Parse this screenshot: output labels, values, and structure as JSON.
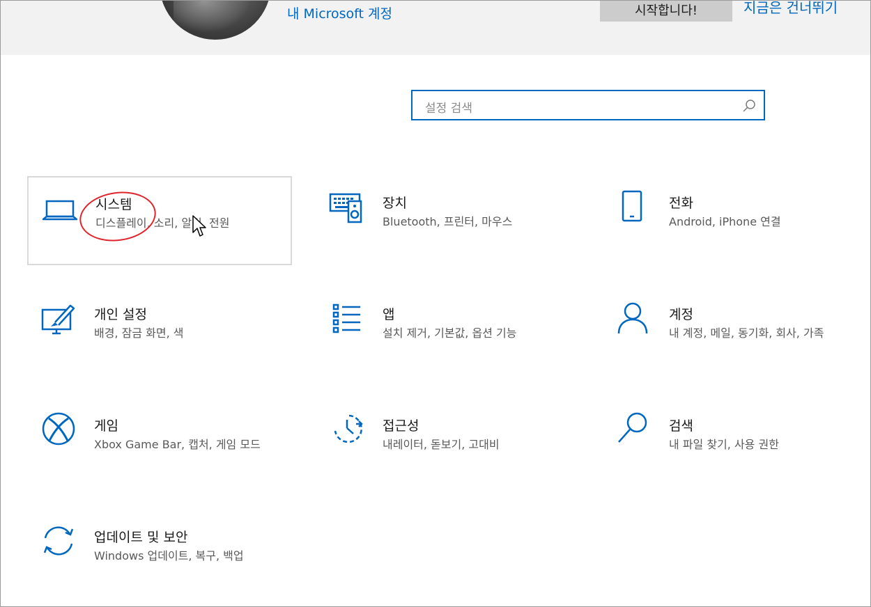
{
  "header": {
    "account_link": "내 Microsoft 계정",
    "start_button": "시작합니다!",
    "skip_link": "지금은 건너뛰기"
  },
  "search": {
    "placeholder": "설정 검색",
    "icon": "search-icon"
  },
  "tiles": [
    {
      "id": "system",
      "icon": "laptop-icon",
      "title": "시스템",
      "desc": "디스플레이, 소리, 알림, 전원",
      "selected": true
    },
    {
      "id": "devices",
      "icon": "keyboard-speaker-icon",
      "title": "장치",
      "desc": "Bluetooth, 프린터, 마우스"
    },
    {
      "id": "phone",
      "icon": "phone-icon",
      "title": "전화",
      "desc": "Android, iPhone 연결"
    },
    {
      "id": "personalization",
      "icon": "personalization-icon",
      "title": "개인 설정",
      "desc": "배경, 잠금 화면, 색"
    },
    {
      "id": "apps",
      "icon": "apps-list-icon",
      "title": "앱",
      "desc": "설치 제거, 기본값, 옵션 기능"
    },
    {
      "id": "accounts",
      "icon": "person-icon",
      "title": "계정",
      "desc": "내 계정, 메일, 동기화, 회사, 가족"
    },
    {
      "id": "gaming",
      "icon": "xbox-icon",
      "title": "게임",
      "desc": "Xbox Game Bar, 캡처, 게임 모드"
    },
    {
      "id": "ease-of-access",
      "icon": "ease-of-access-icon",
      "title": "접근성",
      "desc": "내레이터, 돋보기, 고대비"
    },
    {
      "id": "search",
      "icon": "search-magnifier-icon",
      "title": "검색",
      "desc": "내 파일 찾기, 사용 권한"
    },
    {
      "id": "update",
      "icon": "sync-arrows-icon",
      "title": "업데이트 및 보안",
      "desc": "Windows 업데이트, 복구, 백업"
    }
  ],
  "colors": {
    "accent": "#0067c0",
    "header_bg": "#f2f2f2",
    "annotation": "#e0242c"
  }
}
